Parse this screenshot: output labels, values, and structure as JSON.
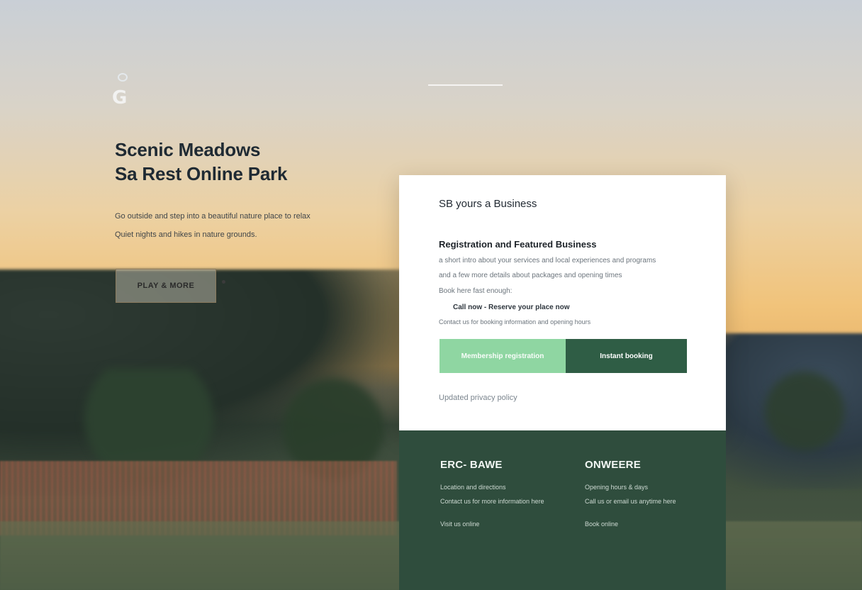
{
  "hero": {
    "title_line1": "Scenic Meadows",
    "title_line2": "Sa Rest Online Park",
    "subtitle_line1": "Go outside and step into a beautiful nature place to relax",
    "subtitle_line2": "Quiet nights and hikes in nature grounds.",
    "button_label": "PLAY & MORE"
  },
  "card": {
    "title": "SB yours a Business",
    "heading": "Registration and Featured Business",
    "line1": "a short intro about your services and local experiences and programs",
    "line2": "and a few more details about packages and opening times",
    "line3": "Book here fast enough:",
    "line4": "Call now - Reserve your place now",
    "line5": "Contact us for booking information and opening hours",
    "btn_secondary": "Membership registration",
    "btn_primary": "Instant booking",
    "footnote": "Updated privacy policy"
  },
  "footer": {
    "left": {
      "heading": "ERC- BAWE",
      "row1": "Location and directions",
      "row2": "Contact us for more information here",
      "row3": "Visit us online"
    },
    "right": {
      "heading": "ONWEERE",
      "row1": "Opening hours & days",
      "row2": "Call us or email us anytime here",
      "row3": "Book online"
    }
  }
}
